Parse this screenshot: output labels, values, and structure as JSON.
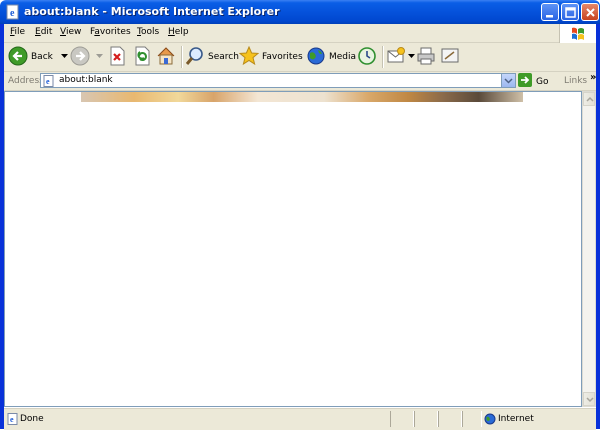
{
  "window": {
    "title": "about:blank - Microsoft Internet Explorer"
  },
  "menu": {
    "items": [
      "File",
      "Edit",
      "View",
      "Favorites",
      "Tools",
      "Help"
    ],
    "underlines": [
      "F",
      "E",
      "V",
      "a",
      "T",
      "H"
    ]
  },
  "toolbar": {
    "back_label": "Back",
    "search_label": "Search",
    "favorites_label": "Favorites",
    "media_label": "Media"
  },
  "address": {
    "label": "Address",
    "url": "about:blank",
    "go_label": "Go",
    "links_label": "Links"
  },
  "status": {
    "text": "Done",
    "zone": "Internet"
  },
  "colors": {
    "titlebar": "#0552db",
    "chrome": "#ece9d8",
    "accent_green": "#3f9b28"
  }
}
